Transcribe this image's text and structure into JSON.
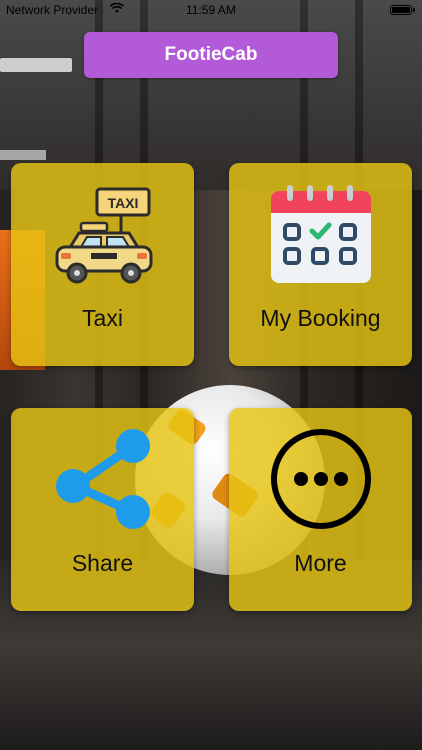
{
  "status_bar": {
    "carrier": "Network Provider",
    "time": "11:59 AM"
  },
  "app": {
    "title": "FootieCab",
    "title_color": "#b35ad8",
    "tile_color": "#e6c412"
  },
  "tiles": [
    {
      "label": "Taxi",
      "icon": "taxi-icon",
      "sign_text": "TAXI"
    },
    {
      "label": "My Booking",
      "icon": "calendar-icon"
    },
    {
      "label": "Share",
      "icon": "share-icon"
    },
    {
      "label": "More",
      "icon": "more-icon"
    }
  ]
}
